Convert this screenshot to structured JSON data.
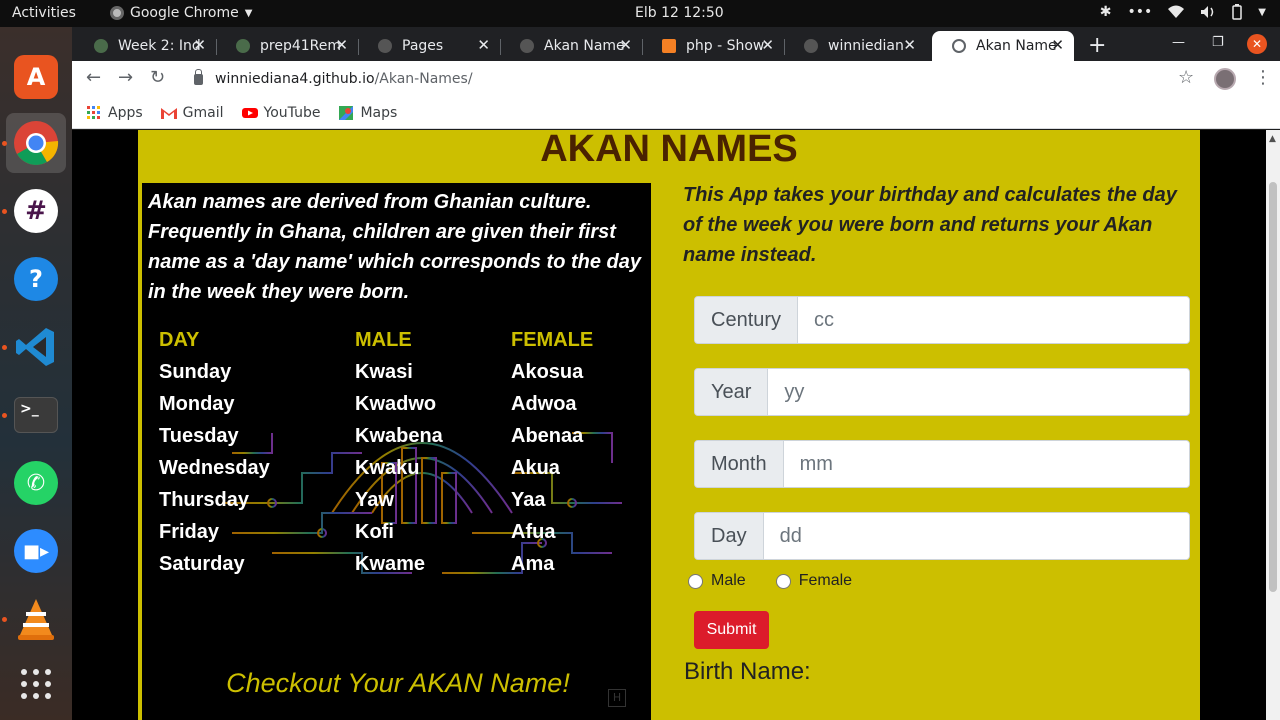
{
  "topbar": {
    "activities": "Activities",
    "app_name": "Google Chrome",
    "clock": "Elb 12  12:50"
  },
  "tabs": [
    {
      "title": "Week 2: Ind",
      "favicon_color": "#4a6b4a"
    },
    {
      "title": "prep41Rem",
      "favicon_color": "#4a6b4a"
    },
    {
      "title": "Pages",
      "favicon_color": "#555555"
    },
    {
      "title": "Akan Name",
      "favicon_color": "#555555"
    },
    {
      "title": "php - Show",
      "favicon_color": "#f48024"
    },
    {
      "title": "winniedian",
      "favicon_color": "#555555"
    },
    {
      "title": "Akan Name",
      "favicon_color": "#5f6368",
      "active": true
    }
  ],
  "omnibox": {
    "host": "winniediana4.github.io",
    "path": "/Akan-Names/"
  },
  "bookmarks": [
    {
      "label": "Apps",
      "icon": "apps-grid-icon"
    },
    {
      "label": "Gmail",
      "icon": "gmail-icon"
    },
    {
      "label": "YouTube",
      "icon": "youtube-icon"
    },
    {
      "label": "Maps",
      "icon": "maps-icon"
    }
  ],
  "page": {
    "title": "AKAN NAMES",
    "intro": "Akan names are derived from Ghanian culture. Frequently in Ghana, children are given their first name as a 'day name' which corresponds to the day in the week they were born.",
    "table": {
      "headers": [
        "DAY",
        "MALE",
        "FEMALE"
      ],
      "days": [
        "Sunday",
        "Monday",
        "Tuesday",
        "Wednesday",
        "Thursday",
        "Friday",
        "Saturday"
      ],
      "male": [
        "Kwasi",
        "Kwadwo",
        "Kwabena",
        "Kwaku",
        "Yaw",
        "Kofi",
        "Kwame"
      ],
      "female": [
        "Akosua",
        "Adwoa",
        "Abenaa",
        "Akua",
        "Yaa",
        "Afua",
        "Ama"
      ]
    },
    "checkout": "Checkout Your AKAN Name!",
    "app_description": "This App takes your birthday and calculates the day of the week you were born and returns your Akan name instead.",
    "form": {
      "century": {
        "label": "Century",
        "placeholder": "cc",
        "value": ""
      },
      "year": {
        "label": "Year",
        "placeholder": "yy",
        "value": ""
      },
      "month": {
        "label": "Month",
        "placeholder": "mm",
        "value": ""
      },
      "day": {
        "label": "Day",
        "placeholder": "dd",
        "value": ""
      },
      "gender_options": [
        "Male",
        "Female"
      ],
      "submit_label": "Submit"
    },
    "birth_name_label": "Birth Name:"
  },
  "colors": {
    "page_yellow": "#ccbf00",
    "title_brown": "#4a2200",
    "submit_red": "#dc1c2b",
    "ubuntu_orange": "#e95420"
  }
}
